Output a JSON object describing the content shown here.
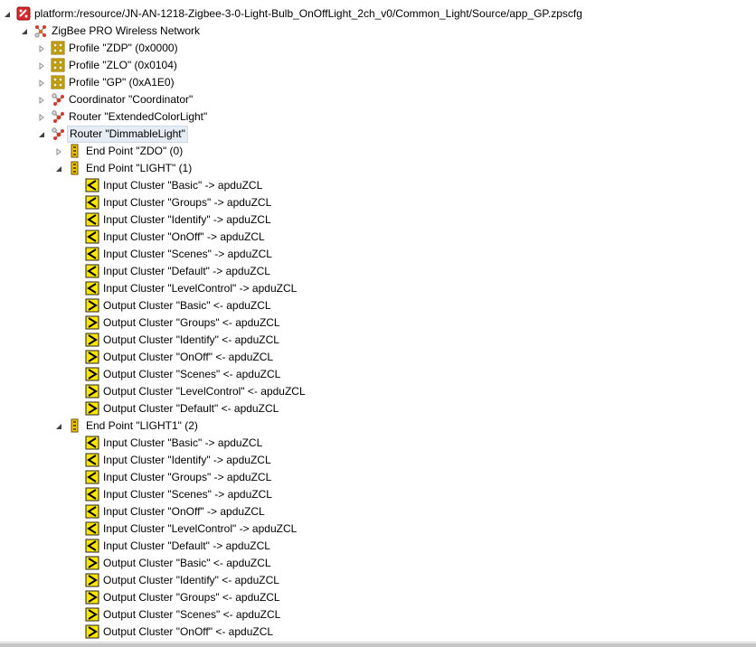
{
  "tree": {
    "rows": [
      {
        "level": 0,
        "arrow": "expanded",
        "icon": "project-config-icon",
        "text": "platform:/resource/JN-AN-1218-Zigbee-3-0-Light-Bulb_OnOffLight_2ch_v0/Common_Light/Source/app_GP.zpscfg"
      },
      {
        "level": 1,
        "arrow": "expanded",
        "icon": "network-icon",
        "text": "ZigBee PRO Wireless Network"
      },
      {
        "level": 2,
        "arrow": "collapsed",
        "icon": "profile-icon",
        "text": "Profile \"ZDP\" (0x0000)"
      },
      {
        "level": 2,
        "arrow": "collapsed",
        "icon": "profile-icon",
        "text": "Profile \"ZLO\" (0x0104)"
      },
      {
        "level": 2,
        "arrow": "collapsed",
        "icon": "profile-icon",
        "text": "Profile \"GP\" (0xA1E0)"
      },
      {
        "level": 2,
        "arrow": "collapsed",
        "icon": "node-icon",
        "text": "Coordinator \"Coordinator\""
      },
      {
        "level": 2,
        "arrow": "collapsed",
        "icon": "node-icon",
        "text": "Router \"ExtendedColorLight\""
      },
      {
        "level": 2,
        "arrow": "expanded",
        "icon": "node-icon",
        "text": "Router \"DimmableLight\"",
        "selected": true
      },
      {
        "level": 3,
        "arrow": "collapsed",
        "icon": "endpoint-icon",
        "text": "End Point \"ZDO\" (0)"
      },
      {
        "level": 3,
        "arrow": "expanded",
        "icon": "endpoint-icon",
        "text": "End Point \"LIGHT\" (1)"
      },
      {
        "level": 4,
        "arrow": "none",
        "icon": "input-cluster-icon",
        "text": "Input Cluster \"Basic\" -> apduZCL"
      },
      {
        "level": 4,
        "arrow": "none",
        "icon": "input-cluster-icon",
        "text": "Input Cluster \"Groups\" -> apduZCL"
      },
      {
        "level": 4,
        "arrow": "none",
        "icon": "input-cluster-icon",
        "text": "Input Cluster \"Identify\" -> apduZCL"
      },
      {
        "level": 4,
        "arrow": "none",
        "icon": "input-cluster-icon",
        "text": "Input Cluster \"OnOff\" -> apduZCL"
      },
      {
        "level": 4,
        "arrow": "none",
        "icon": "input-cluster-icon",
        "text": "Input Cluster \"Scenes\" -> apduZCL"
      },
      {
        "level": 4,
        "arrow": "none",
        "icon": "input-cluster-icon",
        "text": "Input Cluster \"Default\" -> apduZCL"
      },
      {
        "level": 4,
        "arrow": "none",
        "icon": "input-cluster-icon",
        "text": "Input Cluster \"LevelControl\" -> apduZCL"
      },
      {
        "level": 4,
        "arrow": "none",
        "icon": "output-cluster-icon",
        "text": "Output Cluster \"Basic\" <- apduZCL"
      },
      {
        "level": 4,
        "arrow": "none",
        "icon": "output-cluster-icon",
        "text": "Output Cluster \"Groups\" <- apduZCL"
      },
      {
        "level": 4,
        "arrow": "none",
        "icon": "output-cluster-icon",
        "text": "Output Cluster \"Identify\" <- apduZCL"
      },
      {
        "level": 4,
        "arrow": "none",
        "icon": "output-cluster-icon",
        "text": "Output Cluster \"OnOff\" <- apduZCL"
      },
      {
        "level": 4,
        "arrow": "none",
        "icon": "output-cluster-icon",
        "text": "Output Cluster \"Scenes\" <- apduZCL"
      },
      {
        "level": 4,
        "arrow": "none",
        "icon": "output-cluster-icon",
        "text": "Output Cluster \"LevelControl\" <- apduZCL"
      },
      {
        "level": 4,
        "arrow": "none",
        "icon": "output-cluster-icon",
        "text": "Output Cluster \"Default\" <- apduZCL"
      },
      {
        "level": 3,
        "arrow": "expanded",
        "icon": "endpoint-icon",
        "text": "End Point \"LIGHT1\" (2)"
      },
      {
        "level": 4,
        "arrow": "none",
        "icon": "input-cluster-icon",
        "text": "Input Cluster \"Basic\" -> apduZCL"
      },
      {
        "level": 4,
        "arrow": "none",
        "icon": "input-cluster-icon",
        "text": "Input Cluster \"Identify\" -> apduZCL"
      },
      {
        "level": 4,
        "arrow": "none",
        "icon": "input-cluster-icon",
        "text": "Input Cluster \"Groups\" -> apduZCL"
      },
      {
        "level": 4,
        "arrow": "none",
        "icon": "input-cluster-icon",
        "text": "Input Cluster \"Scenes\" -> apduZCL"
      },
      {
        "level": 4,
        "arrow": "none",
        "icon": "input-cluster-icon",
        "text": "Input Cluster \"OnOff\" -> apduZCL"
      },
      {
        "level": 4,
        "arrow": "none",
        "icon": "input-cluster-icon",
        "text": "Input Cluster \"LevelControl\" -> apduZCL"
      },
      {
        "level": 4,
        "arrow": "none",
        "icon": "input-cluster-icon",
        "text": "Input Cluster \"Default\" -> apduZCL"
      },
      {
        "level": 4,
        "arrow": "none",
        "icon": "output-cluster-icon",
        "text": "Output Cluster \"Basic\" <- apduZCL"
      },
      {
        "level": 4,
        "arrow": "none",
        "icon": "output-cluster-icon",
        "text": "Output Cluster \"Identify\" <- apduZCL"
      },
      {
        "level": 4,
        "arrow": "none",
        "icon": "output-cluster-icon",
        "text": "Output Cluster \"Groups\" <- apduZCL"
      },
      {
        "level": 4,
        "arrow": "none",
        "icon": "output-cluster-icon",
        "text": "Output Cluster \"Scenes\" <- apduZCL"
      },
      {
        "level": 4,
        "arrow": "none",
        "icon": "output-cluster-icon",
        "text": "Output Cluster \"OnOff\" <- apduZCL"
      }
    ]
  },
  "colors": {
    "selection_bg": "#e6ecf3",
    "cluster_yellow": "#ffe600",
    "profile_yellow": "#f2c200",
    "project_red": "#d8292f",
    "node_red": "#d33a2c"
  }
}
